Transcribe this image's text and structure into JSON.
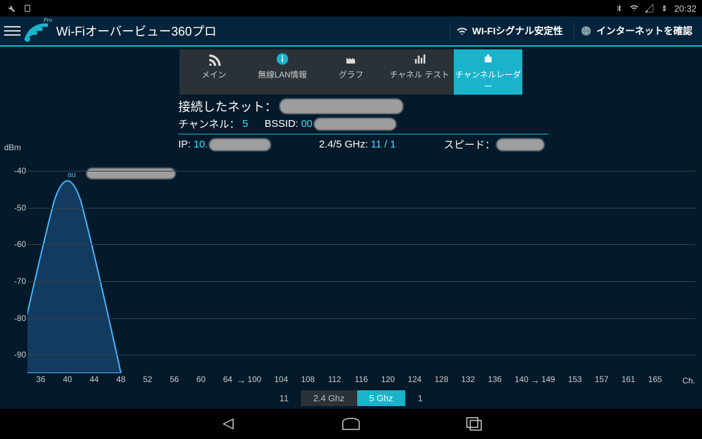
{
  "status": {
    "time": "20:32"
  },
  "header": {
    "title": "Wi-Fiオーバービュー360プロ",
    "stability": "WI-FIシグナル安定性",
    "internet": "インターネットを確認",
    "logo_badge": "Pro"
  },
  "tabs": {
    "main": "メイン",
    "wlan_info": "無線LAN情報",
    "graph": "グラフ",
    "channel_test": "チャネル テスト",
    "channel_radar": "チャンネルレーダー"
  },
  "info": {
    "connected_label": "接続したネット：",
    "channel_label": "チャンネル：",
    "channel_value": "5",
    "bssid_label": "BSSID:",
    "bssid_prefix": "00",
    "ip_label": "IP:",
    "ip_prefix": "10.",
    "band_label": "2.4/5 GHz:",
    "band_value": "11 / 1",
    "speed_label": "スピード："
  },
  "bands": {
    "b1": "11",
    "b2": "2.4 Ghz",
    "b3": "5 Ghz",
    "b4": "1"
  },
  "chart_data": {
    "type": "line",
    "title": "",
    "xlabel": "Ch.",
    "ylabel": "dBm",
    "ylim": [
      -95,
      -35
    ],
    "x_ticks": [
      36,
      40,
      44,
      48,
      52,
      56,
      60,
      64,
      100,
      104,
      108,
      112,
      116,
      120,
      124,
      128,
      132,
      136,
      140,
      149,
      153,
      157,
      161,
      165
    ],
    "x_breaks_after": [
      64,
      140
    ],
    "series": [
      {
        "name": "au",
        "center_channel": 40,
        "width_channels": 4,
        "peak_dbm": -40,
        "color": "#4ab4ff"
      }
    ]
  }
}
